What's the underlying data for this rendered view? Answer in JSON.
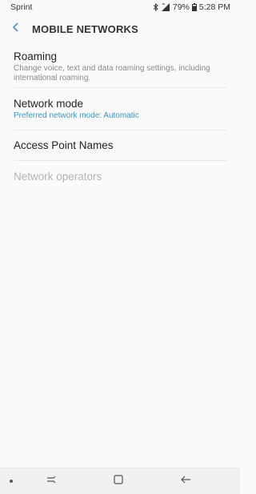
{
  "status_bar": {
    "carrier": "Sprint",
    "battery_percent": "79%",
    "time": "5:28 PM",
    "icons": [
      "bluetooth-icon",
      "signal-icon",
      "battery-icon"
    ]
  },
  "app_bar": {
    "title": "MOBILE NETWORKS",
    "back_icon": "back-arrow-icon"
  },
  "settings": {
    "items": [
      {
        "title": "Roaming",
        "subtitle": "Change voice, text and data roaming settings, including international roaming.",
        "enabled": true
      },
      {
        "title": "Network mode",
        "subtitle": "Preferred network mode: Automatic",
        "enabled": true
      },
      {
        "title": "Access Point Names",
        "enabled": true
      },
      {
        "title": "Network operators",
        "enabled": false
      }
    ]
  },
  "colors": {
    "accent": "#3c97c9",
    "background": "#fafafa",
    "nav_bar": "#f0f0f0"
  },
  "nav_bar": {
    "buttons": [
      "recents-icon",
      "home-icon",
      "back-icon"
    ]
  }
}
